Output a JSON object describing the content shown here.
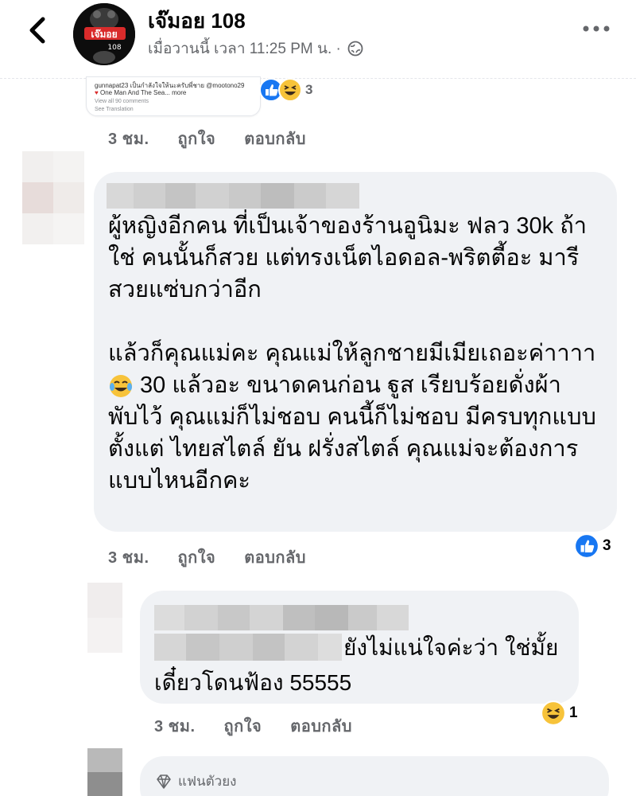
{
  "header": {
    "page_name": "เจ๊มอย 108",
    "post_time": "เมื่อวานนี้ เวลา 11:25 PM น. ·",
    "avatar_text": "เจ๊มอย",
    "avatar_num": "108"
  },
  "first_comment": {
    "caption_user_line": "gunnapat23 เป็นกำลังใจให้นะครับพี่ชาย @mootono29",
    "caption_line2": "One Man And The Sea... more",
    "caption_line3": "View all 90 comments",
    "caption_line4": "See Translation",
    "reaction_count": "3",
    "time": "3 ชม.",
    "like": "ถูกใจ",
    "reply": "ตอบกลับ"
  },
  "main_comment": {
    "text": "ผู้หญิงอีกคน ที่เป็นเจ้าของร้านอูนิมะ ฟลว 30k ถ้า\nใช่ คนนั้นก็สวย แต่ทรงเน็ตไอดอล-พริตตี้อะ มารี\nสวยแซ่บกว่าอีก\n\nแล้วก็คุณแม่คะ คุณแม่ให้ลูกชายมีเมียเถอะค่าาาา",
    "text_line6": " 30 แล้วอะ ขนาดคนก่อน ฐูส เรียบร้อยดั่งผ้า\nพับไว้ คุณแม่ก็ไม่ชอบ คนนี้ก็ไม่ชอบ มีครบทุกแบบ\nตั้งแต่ ไทยสไตล์ ยัน ฝรั่งสไตล์ คุณแม่จะต้องการ\nแบบไหนอีกคะ",
    "reaction_count": "3",
    "time": "3 ชม.",
    "like": "ถูกใจ",
    "reply": "ตอบกลับ"
  },
  "reply_comment": {
    "text_line1": "ยังไม่แน่ใจค่ะว่า ใช่มั้ย",
    "text_line2": "เดี๋ยวโดนฟ้อง 55555",
    "reaction_count": "1",
    "time": "3 ชม.",
    "like": "ถูกใจ",
    "reply": "ตอบกลับ"
  },
  "third_comment": {
    "badge": "แฟนตัวยง"
  },
  "colors": {
    "like_blue": "#1877f2",
    "haha_yellow": "#f7c33a",
    "bubble_grey": "#f0f2f5",
    "meta_grey": "#65676b"
  }
}
